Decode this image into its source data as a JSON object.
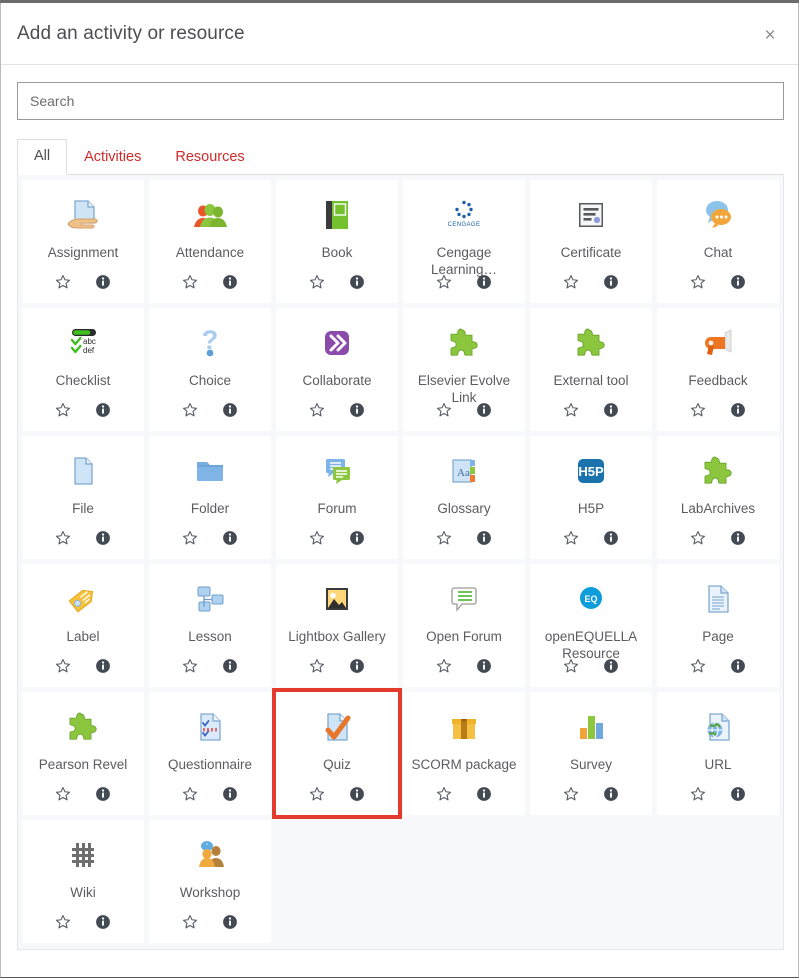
{
  "dialog": {
    "title": "Add an activity or resource",
    "close_label": "×"
  },
  "search": {
    "value": "",
    "placeholder": "Search"
  },
  "tabs": [
    {
      "label": "All",
      "active": true
    },
    {
      "label": "Activities",
      "active": false
    },
    {
      "label": "Resources",
      "active": false
    }
  ],
  "card_actions": {
    "star_name": "star-icon",
    "info_name": "info-icon"
  },
  "colors": {
    "tab_inactive": "#cf2a2a",
    "tab_active_text": "#4e4e51",
    "highlight": "#e23b2e",
    "panel_bg": "#f7f8fa",
    "card_bg": "#ffffff",
    "label_text": "#5c5c5f"
  },
  "items": [
    {
      "label": "Assignment",
      "icon": "assignment-icon",
      "highlighted": false
    },
    {
      "label": "Attendance",
      "icon": "attendance-icon",
      "highlighted": false
    },
    {
      "label": "Book",
      "icon": "book-icon",
      "highlighted": false
    },
    {
      "label": "Cengage Learning…",
      "icon": "cengage-icon",
      "highlighted": false
    },
    {
      "label": "Certificate",
      "icon": "certificate-icon",
      "highlighted": false
    },
    {
      "label": "Chat",
      "icon": "chat-icon",
      "highlighted": false
    },
    {
      "label": "Checklist",
      "icon": "checklist-icon",
      "highlighted": false
    },
    {
      "label": "Choice",
      "icon": "choice-icon",
      "highlighted": false
    },
    {
      "label": "Collaborate",
      "icon": "collaborate-icon",
      "highlighted": false
    },
    {
      "label": "Elsevier Evolve Link",
      "icon": "puzzle-icon",
      "highlighted": false
    },
    {
      "label": "External tool",
      "icon": "puzzle-icon",
      "highlighted": false
    },
    {
      "label": "Feedback",
      "icon": "feedback-icon",
      "highlighted": false
    },
    {
      "label": "File",
      "icon": "file-icon",
      "highlighted": false
    },
    {
      "label": "Folder",
      "icon": "folder-icon",
      "highlighted": false
    },
    {
      "label": "Forum",
      "icon": "forum-icon",
      "highlighted": false
    },
    {
      "label": "Glossary",
      "icon": "glossary-icon",
      "highlighted": false
    },
    {
      "label": "H5P",
      "icon": "h5p-icon",
      "highlighted": false
    },
    {
      "label": "LabArchives",
      "icon": "puzzle-icon",
      "highlighted": false
    },
    {
      "label": "Label",
      "icon": "label-icon",
      "highlighted": false
    },
    {
      "label": "Lesson",
      "icon": "lesson-icon",
      "highlighted": false
    },
    {
      "label": "Lightbox Gallery",
      "icon": "lightbox-gallery-icon",
      "highlighted": false
    },
    {
      "label": "Open Forum",
      "icon": "open-forum-icon",
      "highlighted": false
    },
    {
      "label": "openEQUELLA Resource",
      "icon": "openequella-icon",
      "highlighted": false
    },
    {
      "label": "Page",
      "icon": "page-icon",
      "highlighted": false
    },
    {
      "label": "Pearson Revel",
      "icon": "puzzle-icon",
      "highlighted": false
    },
    {
      "label": "Questionnaire",
      "icon": "questionnaire-icon",
      "highlighted": false
    },
    {
      "label": "Quiz",
      "icon": "quiz-icon",
      "highlighted": true
    },
    {
      "label": "SCORM package",
      "icon": "scorm-icon",
      "highlighted": false
    },
    {
      "label": "Survey",
      "icon": "survey-icon",
      "highlighted": false
    },
    {
      "label": "URL",
      "icon": "url-icon",
      "highlighted": false
    },
    {
      "label": "Wiki",
      "icon": "wiki-icon",
      "highlighted": false
    },
    {
      "label": "Workshop",
      "icon": "workshop-icon",
      "highlighted": false
    }
  ]
}
